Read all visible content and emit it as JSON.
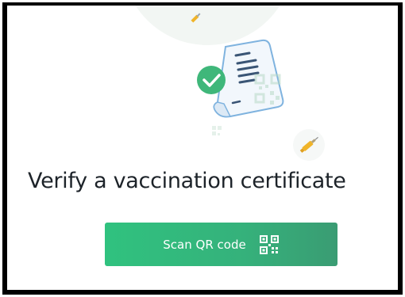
{
  "page": {
    "title": "Verify a vaccination certificate"
  },
  "scan_button": {
    "label": "Scan QR code",
    "icon": "qr-code-icon"
  },
  "illustration": {
    "icons": [
      "certificate-icon",
      "check-icon",
      "qr-code-icon",
      "syringe-icon"
    ]
  },
  "colors": {
    "button_start": "#30c27f",
    "button_end": "#3a9c73",
    "check_green": "#3fb77a",
    "title_text": "#1d2329"
  }
}
